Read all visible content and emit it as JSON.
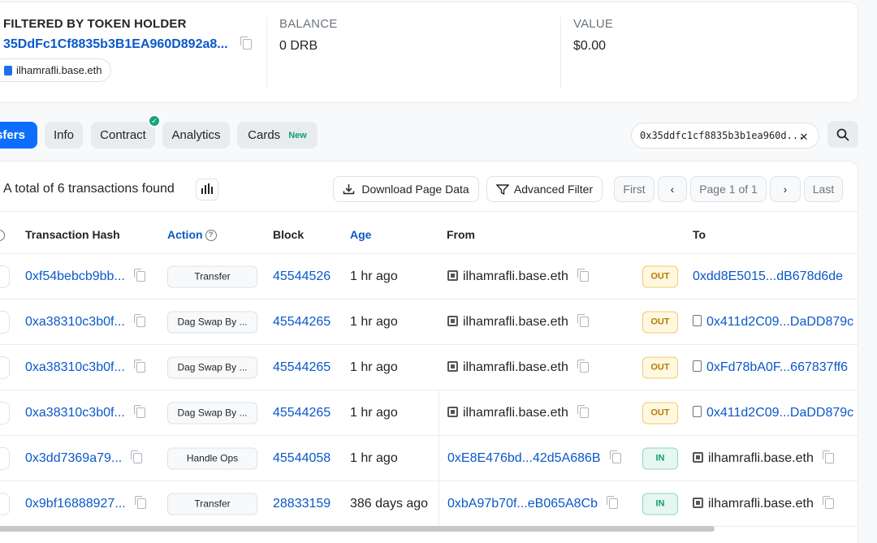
{
  "summary": {
    "filter_label": "FILTERED BY TOKEN HOLDER",
    "holder_address": "35DdFc1Cf8835b3B1EA960D892a8...",
    "holder_name": "ilhamrafli.base.eth",
    "balance_label": "BALANCE",
    "balance_value": "0 DRB",
    "value_label": "VALUE",
    "value_value": "$0.00"
  },
  "tabs": [
    {
      "label": "sfers",
      "active": true
    },
    {
      "label": "Info"
    },
    {
      "label": "Contract"
    },
    {
      "label": "Analytics"
    },
    {
      "label": "Cards",
      "badge": "New"
    }
  ],
  "search": {
    "value": "0x35ddfc1cf8835b3b1ea960d..."
  },
  "toolbar": {
    "total_text": "A total of 6 transactions found",
    "download": "Download Page Data",
    "filter": "Advanced Filter",
    "first": "First",
    "page": "Page 1 of 1",
    "last": "Last"
  },
  "columns": {
    "hash": "Transaction Hash",
    "action": "Action",
    "block": "Block",
    "age": "Age",
    "from": "From",
    "to": "To"
  },
  "rows": [
    {
      "hash": "0xf54bebcb9bb...",
      "action": "Transfer",
      "block": "45544526",
      "age": "1 hr ago",
      "from": "ilhamrafli.base.eth",
      "dir": "OUT",
      "to": "0xdd8E5015...dB678d6de"
    },
    {
      "hash": "0xa38310c3b0f...",
      "action": "Dag Swap By ...",
      "block": "45544265",
      "age": "1 hr ago",
      "from": "ilhamrafli.base.eth",
      "dir": "OUT",
      "to": "0x411d2C09...DaDD879c"
    },
    {
      "hash": "0xa38310c3b0f...",
      "action": "Dag Swap By ...",
      "block": "45544265",
      "age": "1 hr ago",
      "from": "ilhamrafli.base.eth",
      "dir": "OUT",
      "to": "0xFd78bA0F...667837ff6"
    },
    {
      "hash": "0xa38310c3b0f...",
      "action": "Dag Swap By ...",
      "block": "45544265",
      "age": "1 hr ago",
      "from": "ilhamrafli.base.eth",
      "dir": "OUT",
      "to": "0x411d2C09...DaDD879c"
    },
    {
      "hash": "0x3dd7369a79...",
      "action": "Handle Ops",
      "block": "45544058",
      "age": "1 hr ago",
      "from": "0xE8E476bd...42d5A686B",
      "dir": "IN",
      "to": "ilhamrafli.base.eth"
    },
    {
      "hash": "0x9bf16888927...",
      "action": "Transfer",
      "block": "28833159",
      "age": "386 days ago",
      "from": "0xbA97b70f...eB065A8Cb",
      "dir": "IN",
      "to": "ilhamrafli.base.eth"
    }
  ]
}
